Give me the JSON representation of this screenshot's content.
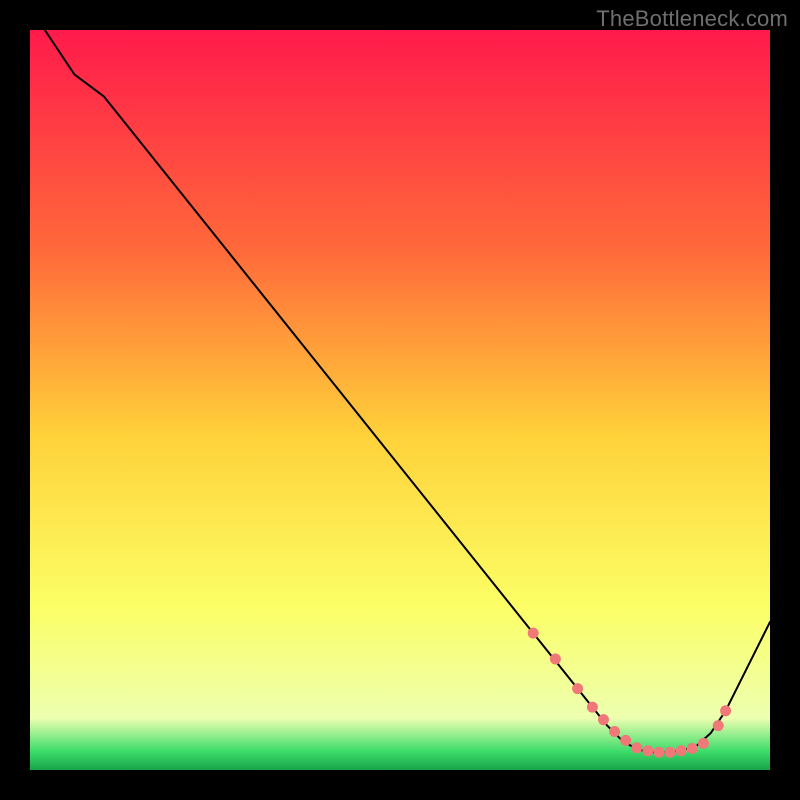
{
  "watermark": "TheBottleneck.com",
  "chart_data": {
    "type": "line",
    "title": "",
    "xlabel": "",
    "ylabel": "",
    "xlim": [
      0,
      100
    ],
    "ylim": [
      0,
      100
    ],
    "background_gradient": {
      "stops": [
        {
          "offset": 0.0,
          "color": "#ff1a4b"
        },
        {
          "offset": 0.3,
          "color": "#ff6a3a"
        },
        {
          "offset": 0.55,
          "color": "#ffd23a"
        },
        {
          "offset": 0.78,
          "color": "#fcff66"
        },
        {
          "offset": 0.93,
          "color": "#edffb0"
        },
        {
          "offset": 0.975,
          "color": "#3bdc6a"
        },
        {
          "offset": 1.0,
          "color": "#1aa34a"
        }
      ]
    },
    "series": [
      {
        "name": "bottleneck-curve",
        "color": "#000000",
        "stroke_width": 2,
        "x": [
          2,
          6,
          10,
          20,
          30,
          40,
          50,
          60,
          68,
          72,
          76,
          78,
          80,
          82,
          84,
          86,
          88,
          90,
          92,
          94,
          100
        ],
        "y": [
          100,
          94,
          91,
          78.5,
          66,
          53.5,
          41,
          28.5,
          18.5,
          13.5,
          8.5,
          6,
          4,
          2.8,
          2.4,
          2.4,
          2.6,
          3.2,
          5,
          8,
          20
        ]
      }
    ],
    "markers": {
      "name": "curve-markers",
      "color": "#f07878",
      "radius": 5.5,
      "x": [
        68,
        71,
        74,
        76,
        77.5,
        79,
        80.5,
        82,
        83.5,
        85,
        86.5,
        88,
        89.5,
        91,
        93,
        94
      ],
      "y": [
        18.5,
        15,
        11,
        8.5,
        6.8,
        5.2,
        4.0,
        3.0,
        2.6,
        2.4,
        2.4,
        2.6,
        2.9,
        3.6,
        6,
        8
      ]
    }
  }
}
